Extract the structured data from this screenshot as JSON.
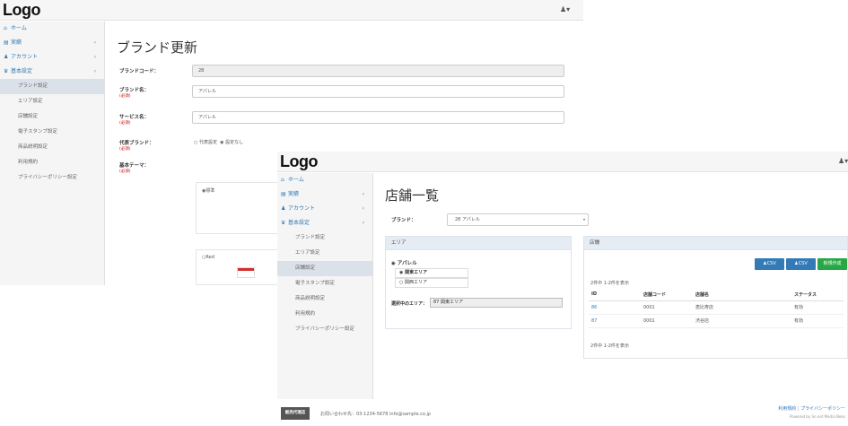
{
  "back": {
    "logo": "Logo",
    "user_icon": "person-icon",
    "nav": [
      {
        "label": "ホーム",
        "icon": "home-icon"
      },
      {
        "label": "実績",
        "icon": "chart-icon",
        "chev": "‹"
      },
      {
        "label": "アカウント",
        "icon": "person-icon",
        "chev": "‹"
      },
      {
        "label": "基本設定",
        "icon": "group-icon",
        "chev": "‹"
      }
    ],
    "sub": [
      "ブランド設定",
      "エリア設定",
      "店舗設定",
      "電子スタンプ設定",
      "商品説明設定",
      "利用規約",
      "プライバシーポリシー設定"
    ],
    "page_title": "ブランド更新",
    "form": {
      "code_label": "ブランドコード：",
      "code_value": "28",
      "name_label": "ブランド名：",
      "name_req": "(必須)",
      "name_value": "アパレル",
      "service_label": "サービス名：",
      "service_req": "(必須)",
      "service_value": "アパレル",
      "rep_label": "代表ブランド：",
      "rep_req": "(必須)",
      "rep_opt1": "代表設定",
      "rep_opt2": "設定なし",
      "theme_label": "基本テーマ：",
      "theme_req": "(必須)",
      "theme_opt1": "標準",
      "theme_opt2": "Red"
    }
  },
  "front": {
    "logo": "Logo",
    "user_icon": "person-icon",
    "nav": [
      {
        "label": "ホーム",
        "icon": "home-icon"
      },
      {
        "label": "実績",
        "icon": "chart-icon",
        "chev": "‹"
      },
      {
        "label": "アカウント",
        "icon": "person-icon",
        "chev": "‹"
      },
      {
        "label": "基本設定",
        "icon": "group-icon",
        "chev": "‹"
      }
    ],
    "sub": [
      "ブランド設定",
      "エリア設定",
      "店舗設定",
      "電子スタンプ設定",
      "商品説明設定",
      "利用規約",
      "プライバシーポリシー設定"
    ],
    "page_title": "店舗一覧",
    "brand_label": "ブランド：",
    "brand_value": "28 アパレル",
    "area_panel": {
      "title": "エリア",
      "root": "アパレル",
      "items": [
        "関東エリア",
        "関西エリア"
      ],
      "selected_label": "選択中のエリア：",
      "selected_value": "87 関東エリア"
    },
    "store_panel": {
      "title": "店舗",
      "btn_csv1": "CSV",
      "btn_csv2": "CSV",
      "btn_new": "新規作成",
      "count_top": "2件中 1-2件を表示",
      "count_bottom": "2件中 1-2件を表示",
      "columns": [
        "ID",
        "店舗コード",
        "店舗名",
        "ステータス"
      ],
      "rows": [
        [
          "86",
          "0001",
          "恵比寿店",
          "有効"
        ],
        [
          "87",
          "0001",
          "渋谷店",
          "有効"
        ]
      ]
    },
    "footer": {
      "brand_box": "販売代理店",
      "contact": "お問い合わせ先：03-1234-5678 info@sample.co.jp",
      "link1": "利用規約",
      "sep": "|",
      "link2": "プライバシーポリシー",
      "powered": "Powered by Sn.net Media Neko"
    }
  },
  "colors": {
    "primary": "#337ab7",
    "success": "#28a745",
    "active_bg": "#dbe1e8",
    "panel_head": "#e6ecf3"
  }
}
